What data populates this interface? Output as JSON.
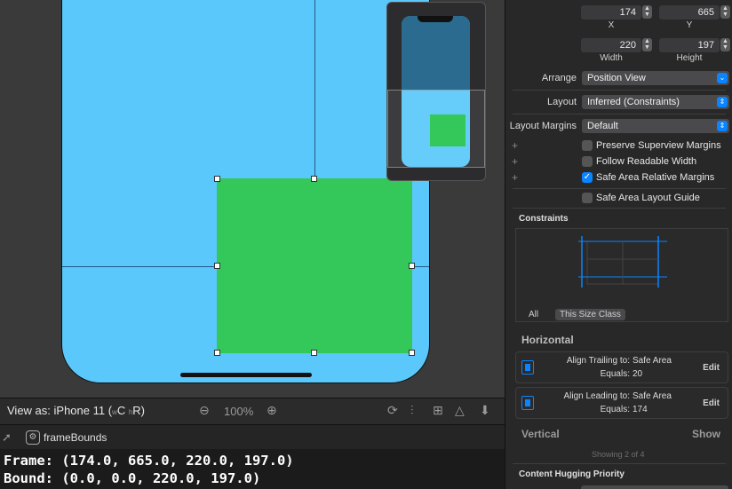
{
  "inspector": {
    "size_position": {
      "x_value": "174",
      "y_value": "665",
      "width_value": "220",
      "height_value": "197",
      "x_caption": "X",
      "y_caption": "Y",
      "width_caption": "Width",
      "height_caption": "Height"
    },
    "arrange": {
      "label": "Arrange",
      "value": "Position View"
    },
    "layout": {
      "label": "Layout",
      "value": "Inferred (Constraints)"
    },
    "layout_margins": {
      "label": "Layout Margins",
      "value": "Default"
    },
    "checkboxes": {
      "preserve_superview": {
        "label": "Preserve Superview Margins",
        "checked": false
      },
      "follow_readable": {
        "label": "Follow Readable Width",
        "checked": false
      },
      "safe_area_relative": {
        "label": "Safe Area Relative Margins",
        "checked": true
      },
      "safe_area_guide": {
        "label": "Safe Area Layout Guide",
        "checked": false
      }
    },
    "constraints": {
      "title": "Constraints",
      "tab_all": "All",
      "tab_size_class": "This Size Class"
    },
    "horizontal": {
      "title": "Horizontal",
      "items": [
        {
          "key1": "Align Trailing to:",
          "val1": "Safe Area",
          "key2": "Equals:",
          "val2": "20",
          "edit": "Edit"
        },
        {
          "key1": "Align Leading to:",
          "val1": "Safe Area",
          "key2": "Equals:",
          "val2": "174",
          "edit": "Edit"
        }
      ]
    },
    "vertical": {
      "title": "Vertical",
      "show": "Show",
      "showing": "Showing 2 of 4"
    },
    "content_hugging": {
      "title": "Content Hugging Priority"
    }
  },
  "canvas": {
    "view_as": "View as: iPhone 11 (",
    "size_w": "w",
    "size_c": "C",
    "size_h": "h",
    "size_r": "R)",
    "zoom": "100%"
  },
  "debug": {
    "frame_label": "frameBounds"
  },
  "console": {
    "line1": "Frame: (174.0, 665.0, 220.0, 197.0)",
    "line2": "Bound: (0.0, 0.0, 220.0, 197.0)"
  },
  "colors": {
    "safe_area_blue": "#5ac8fa",
    "view_green": "#34c759",
    "accent": "#0a84ff"
  }
}
